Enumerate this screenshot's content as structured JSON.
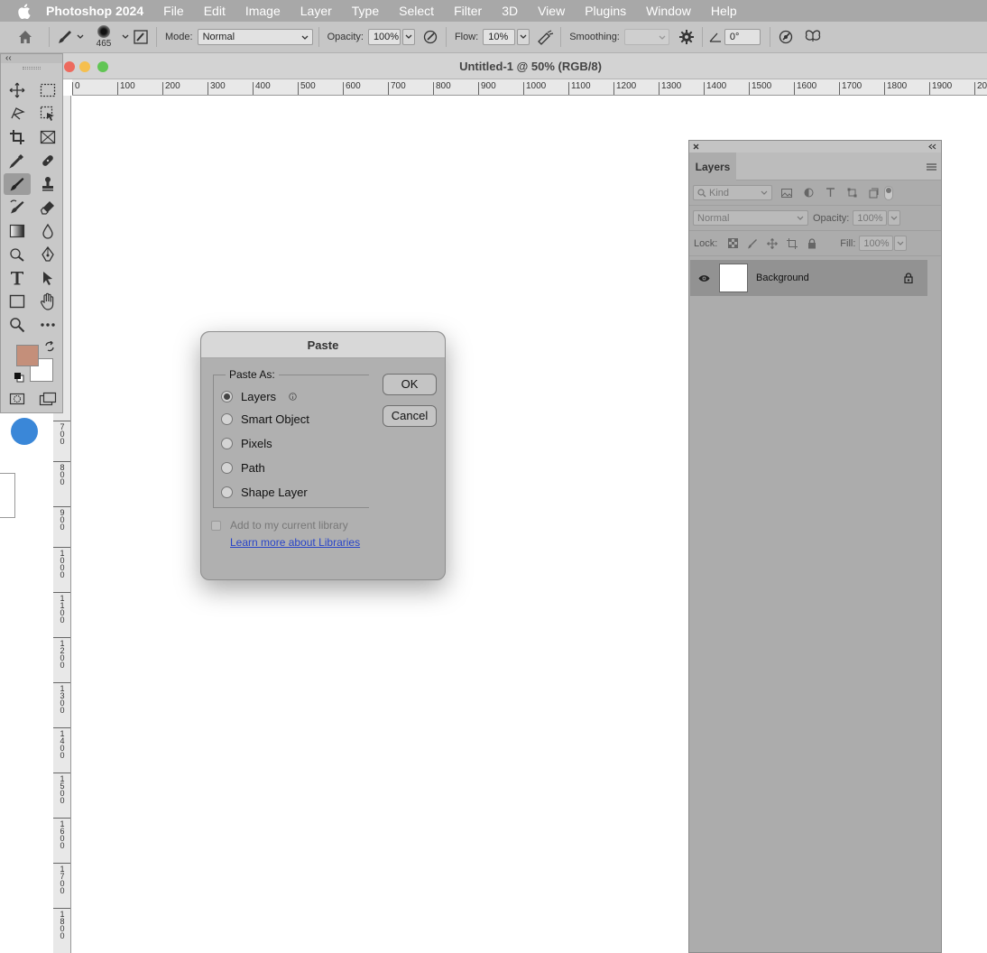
{
  "menubar": {
    "app_name": "Photoshop 2024",
    "items": [
      "File",
      "Edit",
      "Image",
      "Layer",
      "Type",
      "Select",
      "Filter",
      "3D",
      "View",
      "Plugins",
      "Window",
      "Help"
    ]
  },
  "options": {
    "brush_size": "465",
    "mode_label": "Mode:",
    "mode_value": "Normal",
    "opacity_label": "Opacity:",
    "opacity_value": "100%",
    "flow_label": "Flow:",
    "flow_value": "10%",
    "smoothing_label": "Smoothing:",
    "smoothing_value": "",
    "angle_value": "0°"
  },
  "tools": {
    "collapse": "‹‹",
    "foreground_color": "#c48f7a",
    "background_color": "#ffffff"
  },
  "document": {
    "title": "Untitled-1 @ 50% (RGB/8)",
    "hruler_labels": [
      "0",
      "100",
      "200",
      "300",
      "400",
      "500",
      "600",
      "700",
      "800",
      "900",
      "1000",
      "1100",
      "1200",
      "1300",
      "1400",
      "1500",
      "1600",
      "1700",
      "1800",
      "1900",
      "20"
    ],
    "vruler_labels": [
      "7\n0\n0",
      "8\n0\n0",
      "9\n0\n0",
      "1\n0\n0\n0",
      "1\n1\n0\n0",
      "1\n2\n0\n0",
      "1\n3\n0\n0",
      "1\n4\n0\n0",
      "1\n5\n0\n0",
      "1\n6\n0\n0",
      "1\n7\n0\n0",
      "1\n8\n0\n0"
    ]
  },
  "layers_panel": {
    "tab_label": "Layers",
    "filter_kind": "Kind",
    "blend_mode": "Normal",
    "opacity_label": "Opacity:",
    "opacity_value": "100%",
    "lock_label": "Lock:",
    "fill_label": "Fill:",
    "fill_value": "100%",
    "layers": [
      {
        "name": "Background",
        "visible": true,
        "locked": true
      }
    ]
  },
  "paste_dialog": {
    "title": "Paste",
    "group_label": "Paste As:",
    "options": [
      "Layers",
      "Smart Object",
      "Pixels",
      "Path",
      "Shape Layer"
    ],
    "selected": "Layers",
    "ok_label": "OK",
    "cancel_label": "Cancel",
    "library_checkbox_label": "Add to my current library",
    "library_checkbox_checked": false,
    "learn_more_link": "Learn more about Libraries"
  }
}
